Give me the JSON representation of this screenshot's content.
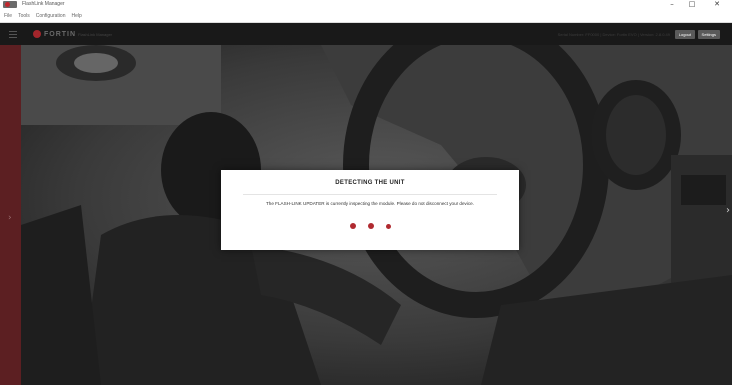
{
  "window": {
    "title": "FlashLink Manager",
    "controls": {
      "minimize": "–",
      "maximize": "□",
      "close": "✕"
    }
  },
  "menu": {
    "items": [
      "File",
      "Tools",
      "Configuration",
      "Help"
    ]
  },
  "header": {
    "brand": "FORTIN",
    "product": "FlashLink Manager",
    "right_text": "Serial Number: FF0000 | Device: Fortin EVO | Version: 2.8.0.49",
    "logout_label": "Logout",
    "settings_label": "Settings"
  },
  "modal": {
    "title": "DETECTING THE UNIT",
    "message": "The FLASH-LINK UPDATER is currently inspecting the module. Please do not disconnect your device."
  },
  "nav": {
    "left_arrow": "›",
    "right_arrow": "›"
  },
  "colors": {
    "accent": "#b02a30",
    "header_bg": "#191919",
    "rail": "#5c1f22"
  },
  "icons": [
    "hamburger-icon",
    "fortin-logo-icon",
    "chevron-right-icon"
  ]
}
